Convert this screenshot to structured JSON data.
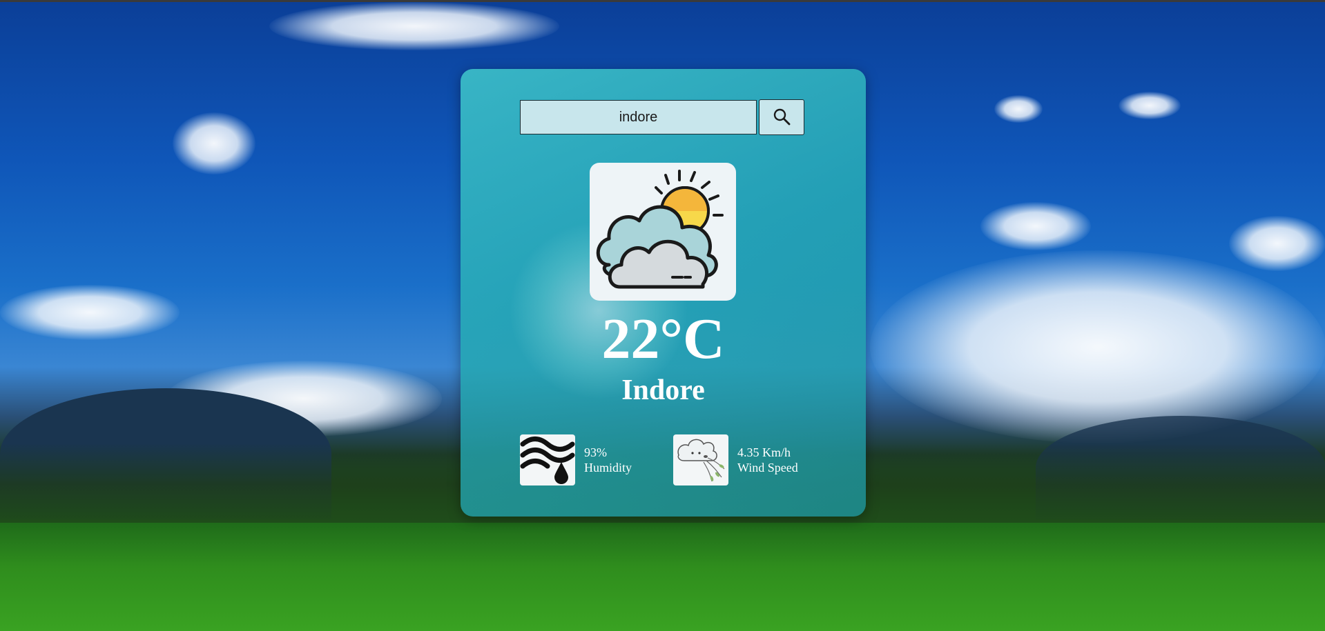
{
  "search": {
    "value": "indore",
    "placeholder": "",
    "button_icon": "search-icon"
  },
  "weather": {
    "icon": "partly-cloudy-icon",
    "temperature": "22°C",
    "city": "Indore"
  },
  "stats": {
    "humidity": {
      "icon": "humidity-icon",
      "value": "93%",
      "label": "Humidity"
    },
    "wind": {
      "icon": "wind-icon",
      "value": "4.35 Km/h",
      "label": "Wind Speed"
    }
  },
  "colors": {
    "card": "#2fb0bb",
    "input_bg": "#c8e6ec",
    "text": "#ffffff"
  }
}
